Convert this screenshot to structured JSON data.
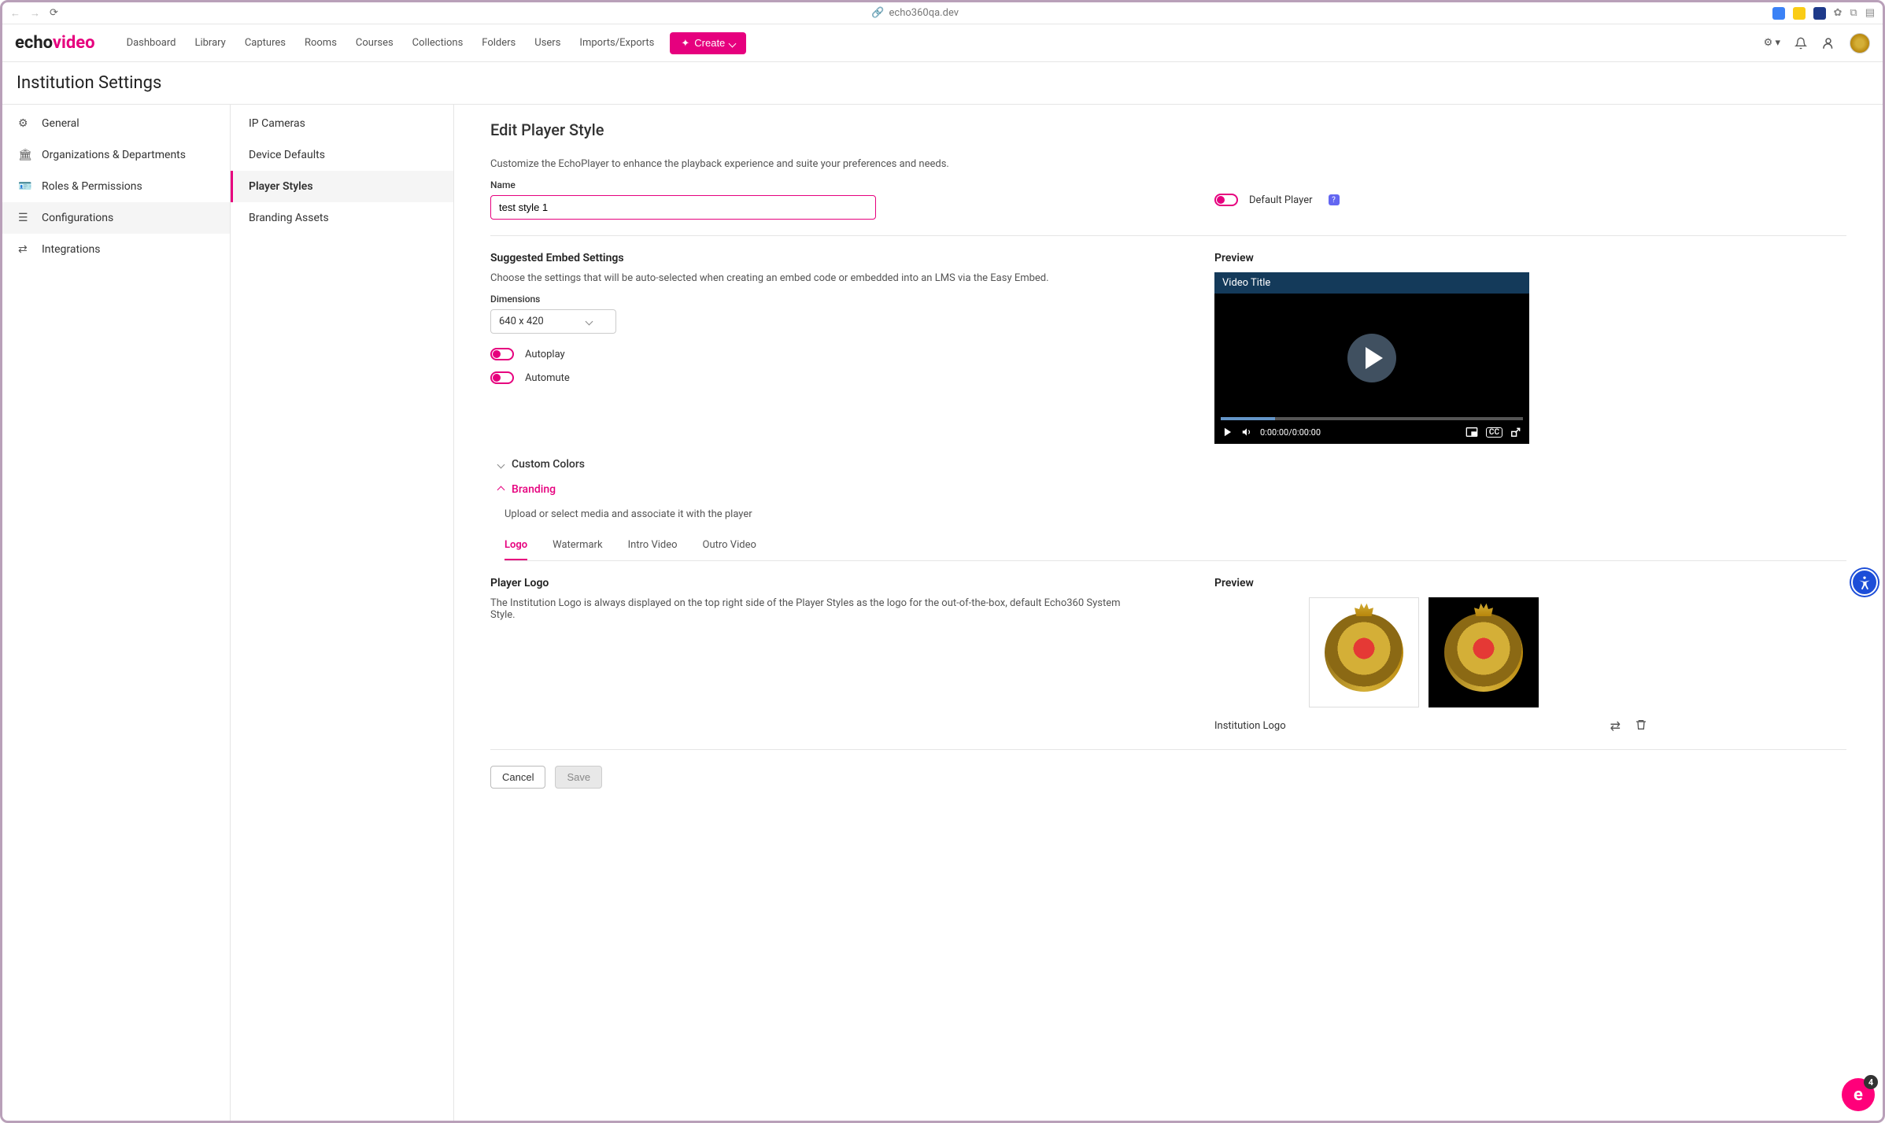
{
  "browser": {
    "url": "echo360qa.dev"
  },
  "topnav": {
    "logo_prefix": "echo",
    "logo_suffix": "video",
    "links": [
      "Dashboard",
      "Library",
      "Captures",
      "Rooms",
      "Courses",
      "Collections",
      "Folders",
      "Users",
      "Imports/Exports"
    ],
    "create_label": "Create"
  },
  "page_title": "Institution Settings",
  "sidebar1": {
    "items": [
      {
        "label": "General"
      },
      {
        "label": "Organizations & Departments"
      },
      {
        "label": "Roles & Permissions"
      },
      {
        "label": "Configurations"
      },
      {
        "label": "Integrations"
      }
    ]
  },
  "sidebar2": {
    "items": [
      {
        "label": "IP Cameras"
      },
      {
        "label": "Device Defaults"
      },
      {
        "label": "Player Styles"
      },
      {
        "label": "Branding Assets"
      }
    ]
  },
  "main": {
    "heading": "Edit Player Style",
    "description": "Customize the EchoPlayer to enhance the playback experience and suite your preferences and needs.",
    "name_label": "Name",
    "name_value": "test style 1",
    "default_player_label": "Default Player",
    "help_badge": "?",
    "embed_section": "Suggested Embed Settings",
    "embed_desc": "Choose the settings that will be auto-selected when creating an embed code or embedded into an LMS via the Easy Embed.",
    "dimensions_label": "Dimensions",
    "dimensions_value": "640 x 420",
    "autoplay_label": "Autoplay",
    "automute_label": "Automute",
    "custom_colors_label": "Custom Colors",
    "branding_label": "Branding",
    "branding_desc": "Upload or select media and associate it with the player",
    "branding_tabs": [
      "Logo",
      "Watermark",
      "Intro Video",
      "Outro Video"
    ],
    "player_logo_heading": "Player Logo",
    "player_logo_desc": "The Institution Logo is always displayed on the top right side of the Player Styles as the logo for the out-of-the-box, default Echo360 System Style.",
    "preview_label": "Preview",
    "institution_logo_label": "Institution Logo",
    "cancel_label": "Cancel",
    "save_label": "Save"
  },
  "player": {
    "title": "Video Title",
    "time": "0:00:00/0:00:00",
    "cc": "CC"
  },
  "chat_count": "4"
}
